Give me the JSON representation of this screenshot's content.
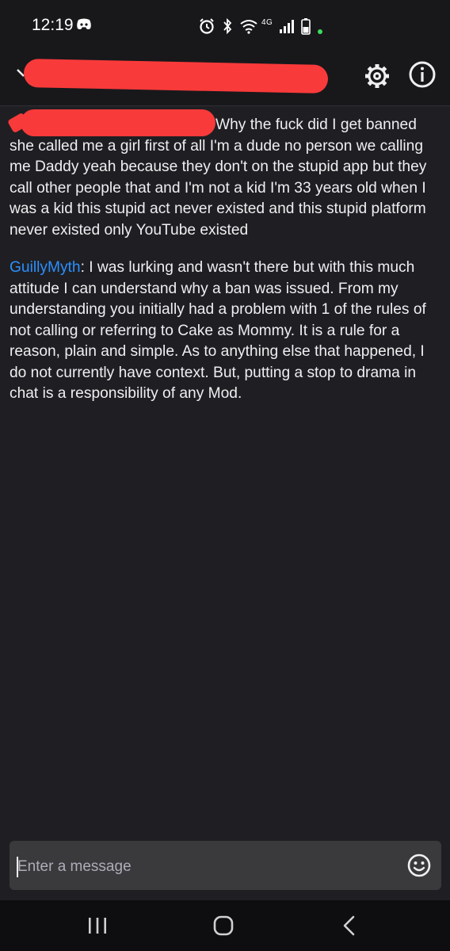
{
  "status_bar": {
    "time": "12:19",
    "network": "4G",
    "icons": [
      "discord-icon",
      "alarm-icon",
      "bluetooth-icon",
      "wifi-icon",
      "signal-icon",
      "battery-icon",
      "active-dot"
    ]
  },
  "header": {
    "icons": [
      "back-icon",
      "settings-icon",
      "info-icon"
    ]
  },
  "messages": [
    {
      "username": "",
      "text": "Why the fuck did I get banned she called me a girl first of all I'm a dude no person we calling me Daddy yeah because they don't on the stupid app but they call other people that and I'm not a kid I'm 33 years old when I was a kid this stupid act never existed and this stupid platform never existed only YouTube existed"
    },
    {
      "username": "GuillyMyth",
      "separator": ": ",
      "text": "I was lurking and wasn't there but with this much attitude I can understand why a ban was issued. From my understanding you initially had a problem with 1 of the rules of not calling or referring to Cake as Mommy. It is a rule for a reason, plain and simple. As to anything else that happened, I do not currently have context. But, putting a stop to drama in chat is a responsibility of any Mod."
    }
  ],
  "composer": {
    "placeholder": "Enter a message"
  },
  "colors": {
    "background": "#1f1f23",
    "header": "#18181b",
    "text": "#efeff1",
    "username": "#2b8fff",
    "redaction": "#f93a3a",
    "input": "#3a3a3d"
  }
}
